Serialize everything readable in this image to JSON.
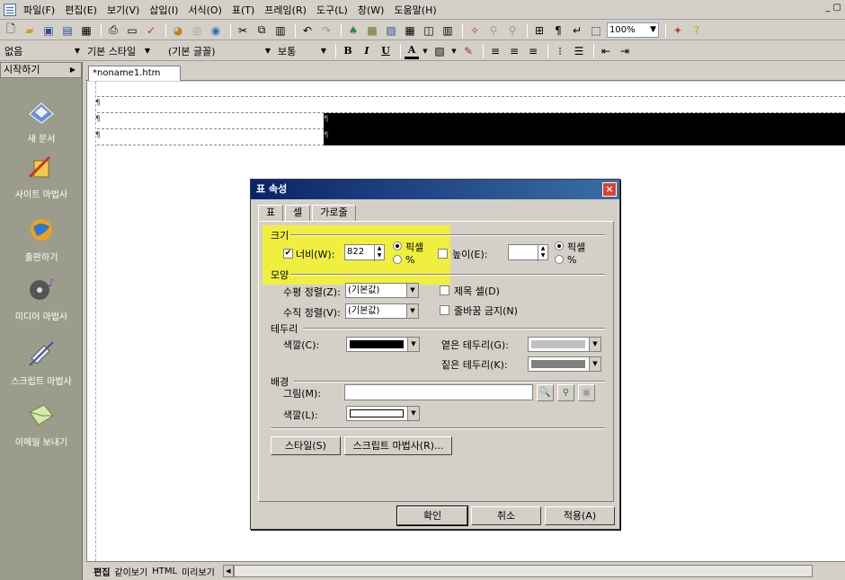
{
  "menubar": {
    "items": [
      "파일(F)",
      "편집(E)",
      "보기(V)",
      "삽입(I)",
      "서식(O)",
      "표(T)",
      "프레임(R)",
      "도구(L)",
      "창(W)",
      "도움말(H)"
    ],
    "window_controls": "_ ▢"
  },
  "toolbar": {
    "zoom": "100%"
  },
  "format_bar": {
    "paragraph_style": "없음",
    "style": "기본 스타일",
    "font": "(기본 글꼴)",
    "size": "보통",
    "bold": "B",
    "italic": "I",
    "underline": "U",
    "font_color": "A"
  },
  "sidebar": {
    "header": "시작하기",
    "items": [
      {
        "label": "새 문서",
        "icon": "new-document-icon"
      },
      {
        "label": "사이트 마법사",
        "icon": "site-wizard-icon"
      },
      {
        "label": "출판하기",
        "icon": "publish-globe-icon"
      },
      {
        "label": "미디어 마법사",
        "icon": "media-wizard-icon"
      },
      {
        "label": "스크립트 마법사",
        "icon": "script-wizard-icon"
      },
      {
        "label": "이메일 보내기",
        "icon": "email-icon"
      }
    ]
  },
  "document_tab": "*noname1.htm",
  "pilcrow": "¶",
  "bottom_tabs": [
    "편집",
    "같이보기",
    "HTML",
    "미리보기"
  ],
  "dialog": {
    "title": "표 속성",
    "close_label": "×",
    "tabs": [
      "표",
      "셀",
      "가로줄"
    ],
    "active_tab": "셀",
    "size_group": "크기",
    "width_checkbox": "너비(W):",
    "width_checked": true,
    "width_value": "822",
    "pixel_label": "픽셀",
    "percent_label": "%",
    "height_checkbox": "높이(E):",
    "height_value": "",
    "shape_group": "모양",
    "halign_label": "수평 정렬(Z):",
    "halign_value": "(기본값)",
    "valign_label": "수직 정렬(V):",
    "valign_value": "(기본값)",
    "header_cell": "제목 셀(D)",
    "no_wrap": "줄바꿈 금지(N)",
    "border_group": "테두리",
    "border_color_label": "색깔(C):",
    "border_color": "#000000",
    "light_border_label": "옅은 테두리(G):",
    "light_border_color": "#c0c0c0",
    "dark_border_label": "짙은 테두리(K):",
    "dark_border_color": "#808080",
    "background_group": "배경",
    "image_label": "그림(M):",
    "image_value": "",
    "bg_color_label": "색깔(L):",
    "bg_color": "#ffffff",
    "style_button": "스타일(S)",
    "script_wizard_button": "스크립트 마법사(R)...",
    "ok_button": "확인",
    "cancel_button": "취소",
    "apply_button": "적용(A)"
  }
}
